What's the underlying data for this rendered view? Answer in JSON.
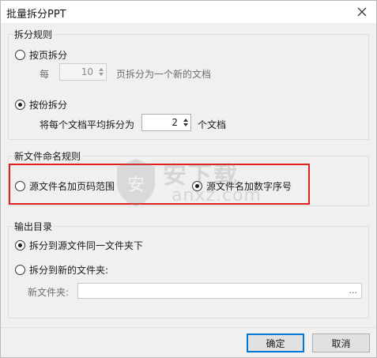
{
  "window": {
    "title": "批量拆分PPT"
  },
  "split_rule": {
    "legend": "拆分规则",
    "by_page": {
      "label": "按页拆分",
      "selected": false,
      "prefix": "每",
      "value": "10",
      "suffix": "页拆分为一个新的文档"
    },
    "by_part": {
      "label": "按份拆分",
      "selected": true,
      "prefix": "将每个文档平均拆分为",
      "value": "2",
      "suffix": "个文档"
    }
  },
  "naming_rule": {
    "legend": "新文件命名规则",
    "option_page_range": {
      "label": "源文件名加页码范围",
      "selected": false
    },
    "option_number_seq": {
      "label": "源文件名加数字序号",
      "selected": true
    }
  },
  "output": {
    "legend": "输出目录",
    "option_same_folder": {
      "label": "拆分到源文件同一文件夹下",
      "selected": true
    },
    "option_new_folder": {
      "label": "拆分到新的文件夹:",
      "selected": false
    },
    "new_folder_label": "新文件夹:",
    "new_folder_value": "",
    "browse": "..."
  },
  "buttons": {
    "ok": "确定",
    "cancel": "取消"
  },
  "watermark": {
    "text_cn": "安下载",
    "text_en": "anxz.com"
  },
  "icons": {
    "close": "close-icon",
    "watermark_shield": "shield-icon"
  }
}
